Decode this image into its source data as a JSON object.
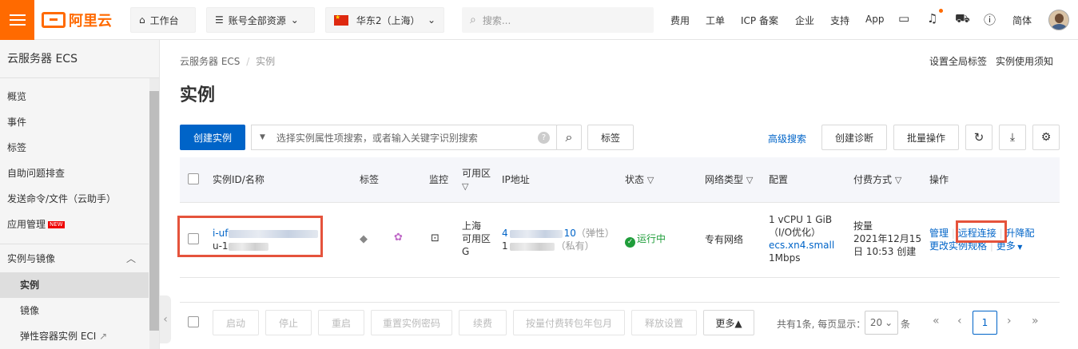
{
  "topbar": {
    "brand": "阿里云",
    "workbench": "工作台",
    "resources": "账号全部资源",
    "region": "华东2（上海）",
    "search_placeholder": "搜索...",
    "nav": [
      "费用",
      "工单",
      "ICP 备案",
      "企业",
      "支持",
      "App"
    ],
    "language": "简体"
  },
  "sidebar": {
    "title": "云服务器 ECS",
    "items": [
      "概览",
      "事件",
      "标签",
      "自助问题排查",
      "发送命令/文件（云助手）",
      "应用管理"
    ],
    "new_badge": "NEW",
    "group": "实例与镜像",
    "sub_items": [
      "实例",
      "镜像",
      "弹性容器实例 ECI"
    ]
  },
  "breadcrumb": {
    "root": "云服务器 ECS",
    "sep": "/",
    "current": "实例"
  },
  "top_links": {
    "global_tags": "设置全局标签",
    "notice": "实例使用须知"
  },
  "page_title": "实例",
  "toolbar": {
    "create": "创建实例",
    "filter_placeholder": "选择实例属性项搜索，或者输入关键字识别搜索",
    "help": "?",
    "tag": "标签",
    "advanced_search": "高级搜索",
    "diagnose": "创建诊断",
    "batch": "批量操作"
  },
  "table": {
    "headers": {
      "id_name": "实例ID/名称",
      "tags": "标签",
      "monitor": "监控",
      "zone": "可用区",
      "ip": "IP地址",
      "status": "状态",
      "network": "网络类型",
      "config": "配置",
      "billing": "付费方式",
      "actions": "操作"
    },
    "row": {
      "id_prefix": "i-uf",
      "name_prefix": "u-1",
      "zone_lines": [
        "上海",
        "可用区",
        "G"
      ],
      "ip_public_prefix": "4",
      "ip_public_suffix": "10",
      "ip_public_label": "（弹性）",
      "ip_private_prefix": "1",
      "ip_private_label": "（私有）",
      "status": "运行中",
      "network": "专有网络",
      "config_lines": [
        "1 vCPU 1 GiB",
        "（I/O优化）"
      ],
      "config_type": "ecs.xn4.small",
      "config_bw": "1Mbps",
      "billing_lines": [
        "按量",
        "2021年12月15",
        "日 10:53 创建"
      ],
      "actions": {
        "manage": "管理",
        "remote": "远程连接",
        "upgrade": "升降配",
        "change_spec": "更改实例规格",
        "more": "更多"
      }
    }
  },
  "footer": {
    "buttons": [
      "启动",
      "停止",
      "重启",
      "重置实例密码",
      "续费",
      "按量付费转包年包月",
      "释放设置"
    ],
    "more": "更多▲",
    "total": "共有1条, 每页显示：",
    "page_size": "20",
    "unit": "条",
    "current_page": "1"
  }
}
